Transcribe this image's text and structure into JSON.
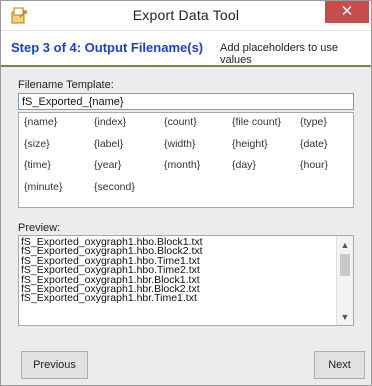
{
  "window": {
    "title": "Export Data Tool",
    "close_glyph": "✕"
  },
  "header": {
    "step": "Step 3 of 4: Output Filename(s)",
    "hint": "Add placeholders to use values"
  },
  "template": {
    "label": "Filename Template:",
    "value": "fS_Exported_{name}"
  },
  "placeholders": [
    "{name}",
    "{index}",
    "{count}",
    "{file count}",
    "{type}",
    "{size}",
    "{label}",
    "{width}",
    "{height}",
    "{date}",
    "{time}",
    "{year}",
    "{month}",
    "{day}",
    "{hour}",
    "{minute}",
    "{second}"
  ],
  "preview": {
    "label": "Preview:",
    "items": [
      "fS_Exported_oxygraph1.hbo.Block1.txt",
      "fS_Exported_oxygraph1.hbo.Block2.txt",
      "fS_Exported_oxygraph1.hbo.Time1.txt",
      "fS_Exported_oxygraph1.hbo.Time2.txt",
      "fS_Exported_oxygraph1.hbr.Block1.txt",
      "fS_Exported_oxygraph1.hbr.Block2.txt",
      "fS_Exported_oxygraph1.hbr.Time1.txt"
    ]
  },
  "buttons": {
    "previous": "Previous",
    "next": "Next"
  },
  "icons": {
    "app": "export-icon",
    "scroll_up": "▲",
    "scroll_down": "▼"
  },
  "colors": {
    "step": "#1c3fc9",
    "accent_line": "#6e8f3f",
    "close": "#c74c4c"
  }
}
